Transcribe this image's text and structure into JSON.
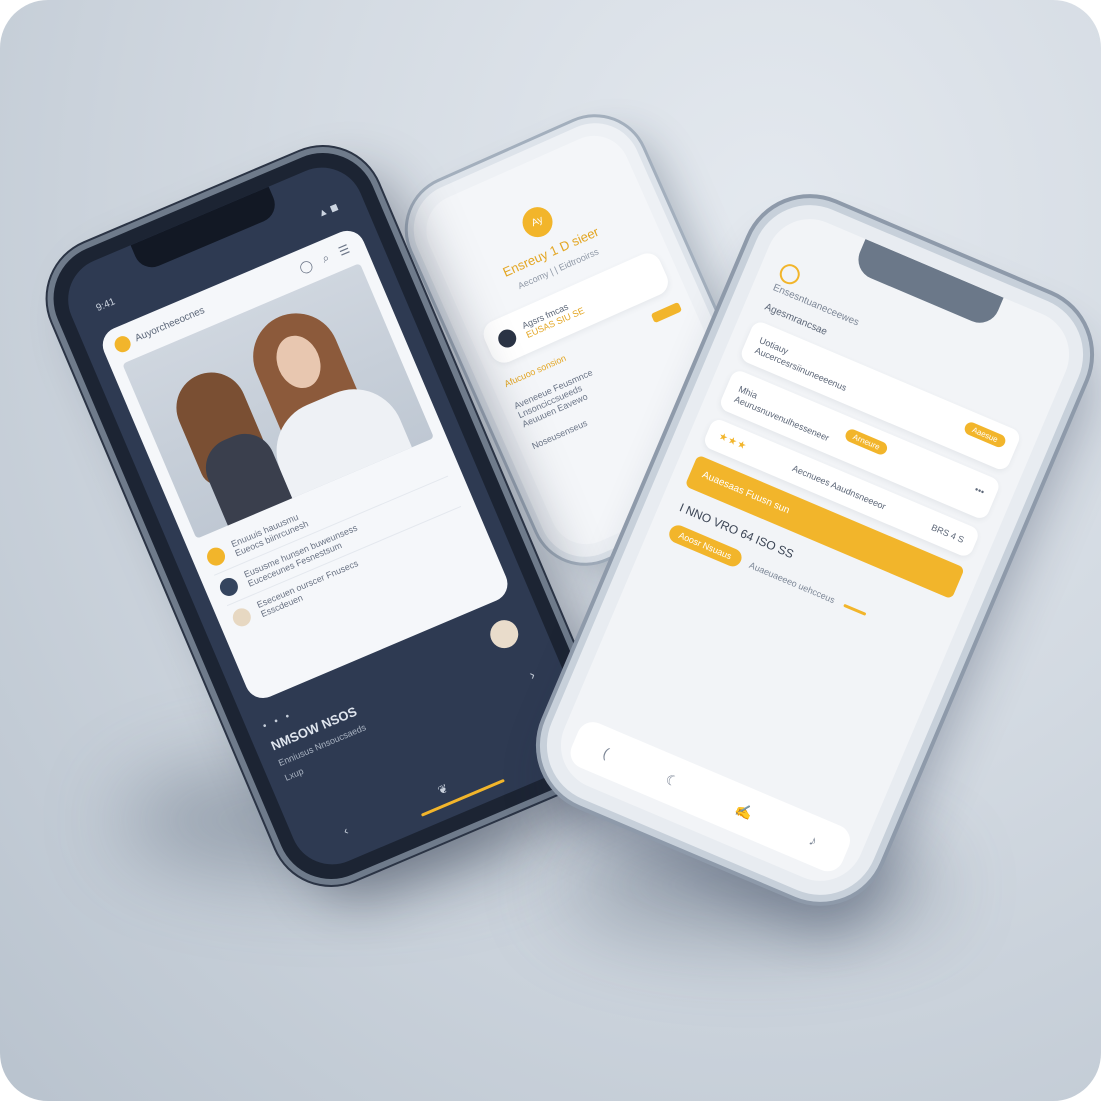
{
  "colors": {
    "accent": "#f2b52b",
    "dark_screen": "#2e3a52",
    "light_screen": "#f2f4f7",
    "background": "#d3dae2"
  },
  "phone_dark": {
    "status": {
      "time": "9:41",
      "icons": "▲ ◼"
    },
    "card": {
      "brand": "Auyorcheeocnes",
      "toolbar_icons": "◯ ⌕ ☰"
    },
    "list": [
      {
        "title": "Enuuuis hauusmu",
        "sub": "Eueocs biinrcunesh"
      },
      {
        "title": "Eususme hunsen buweunsess",
        "sub": "Euceceunes Fesnestsum"
      },
      {
        "title": "Eseceuen ourscer Fnusecs",
        "sub": "Esscdeuen"
      }
    ],
    "bottom": {
      "dots": "• • •",
      "title": "NMSOW NSOS",
      "subtitle": "Enniusus Nnsoucsaeds",
      "badge": "Lxup",
      "arrow": "›"
    },
    "tab_icons": [
      "‹",
      "❦",
      "•"
    ]
  },
  "phone_back": {
    "coin": "Ay",
    "title": "Ensreuy 1 D sieer",
    "subtitle": "Aecomy |  |  Eidtrooirss",
    "card": {
      "line1": "Agsrs fmcas",
      "line2": "EUSAS SIU SE"
    },
    "action_label": "Afucuoo sonsion",
    "list": [
      "Aveneeue Feusmnce",
      "Lnsonciccsueeds",
      "Aeuuuen Eavewo",
      "Noseusenseus"
    ]
  },
  "phone_front": {
    "header": "Ensesntuaneceewes",
    "section": "Agesmrancsae",
    "card1": {
      "title": "Uotiauy",
      "sub": "Aucercesrsiinuneeeenus",
      "pill": "Aaesue"
    },
    "card2": {
      "title": "Mhia",
      "sub": "Aeurusnuvenulhesseneer",
      "pill": "Arneure",
      "more": "•••"
    },
    "rating": {
      "stars": "★★★",
      "text": "Aecnuees Aaudnsneeeor",
      "value": "BRS 4 S"
    },
    "big_button": "Auaesaas Fuusn sun",
    "amount": "I NNO VRO 64 ISO SS",
    "small_button": "Aoosr Nsuaus",
    "small_text": "Auaeuaeeeo uehcceus",
    "tab_icons": [
      "(",
      "☾",
      "✍",
      "♪"
    ]
  }
}
